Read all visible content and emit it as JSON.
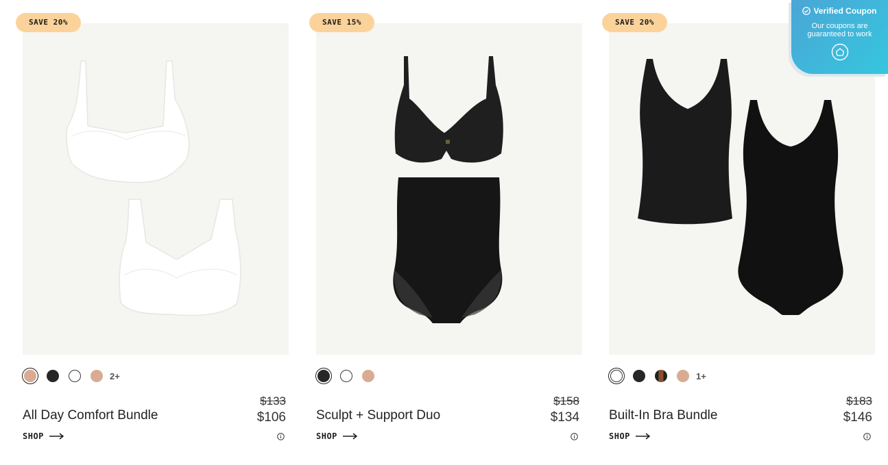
{
  "coupon": {
    "title": "Verified Coupon",
    "subtitle": "Our coupons are guaranteed to work",
    "icons": [
      "check-circle-icon",
      "home-icon"
    ]
  },
  "products": [
    {
      "badge": "SAVE 20%",
      "name": "All Day Comfort Bundle",
      "old_price": "$133",
      "price": "$106",
      "shop_label": "SHOP",
      "swatches": [
        "nude",
        "black",
        "white",
        "nude"
      ],
      "more_colors": "2+",
      "selected_swatch": 0
    },
    {
      "badge": "SAVE 15%",
      "name": "Sculpt + Support Duo",
      "old_price": "$158",
      "price": "$134",
      "shop_label": "SHOP",
      "swatches": [
        "black",
        "white",
        "nude"
      ],
      "more_colors": "",
      "selected_swatch": 0
    },
    {
      "badge": "SAVE 20%",
      "name": "Built-In Bra Bundle",
      "old_price": "$183",
      "price": "$146",
      "shop_label": "SHOP",
      "swatches": [
        "white",
        "black",
        "brown",
        "nude"
      ],
      "more_colors": "1+",
      "selected_swatch": 0
    }
  ],
  "colors": {
    "badge_bg": "#fbd39a",
    "image_bg": "#f5f5f1",
    "coupon_gradient_start": "#4aa6d6",
    "coupon_gradient_end": "#36c6de"
  }
}
